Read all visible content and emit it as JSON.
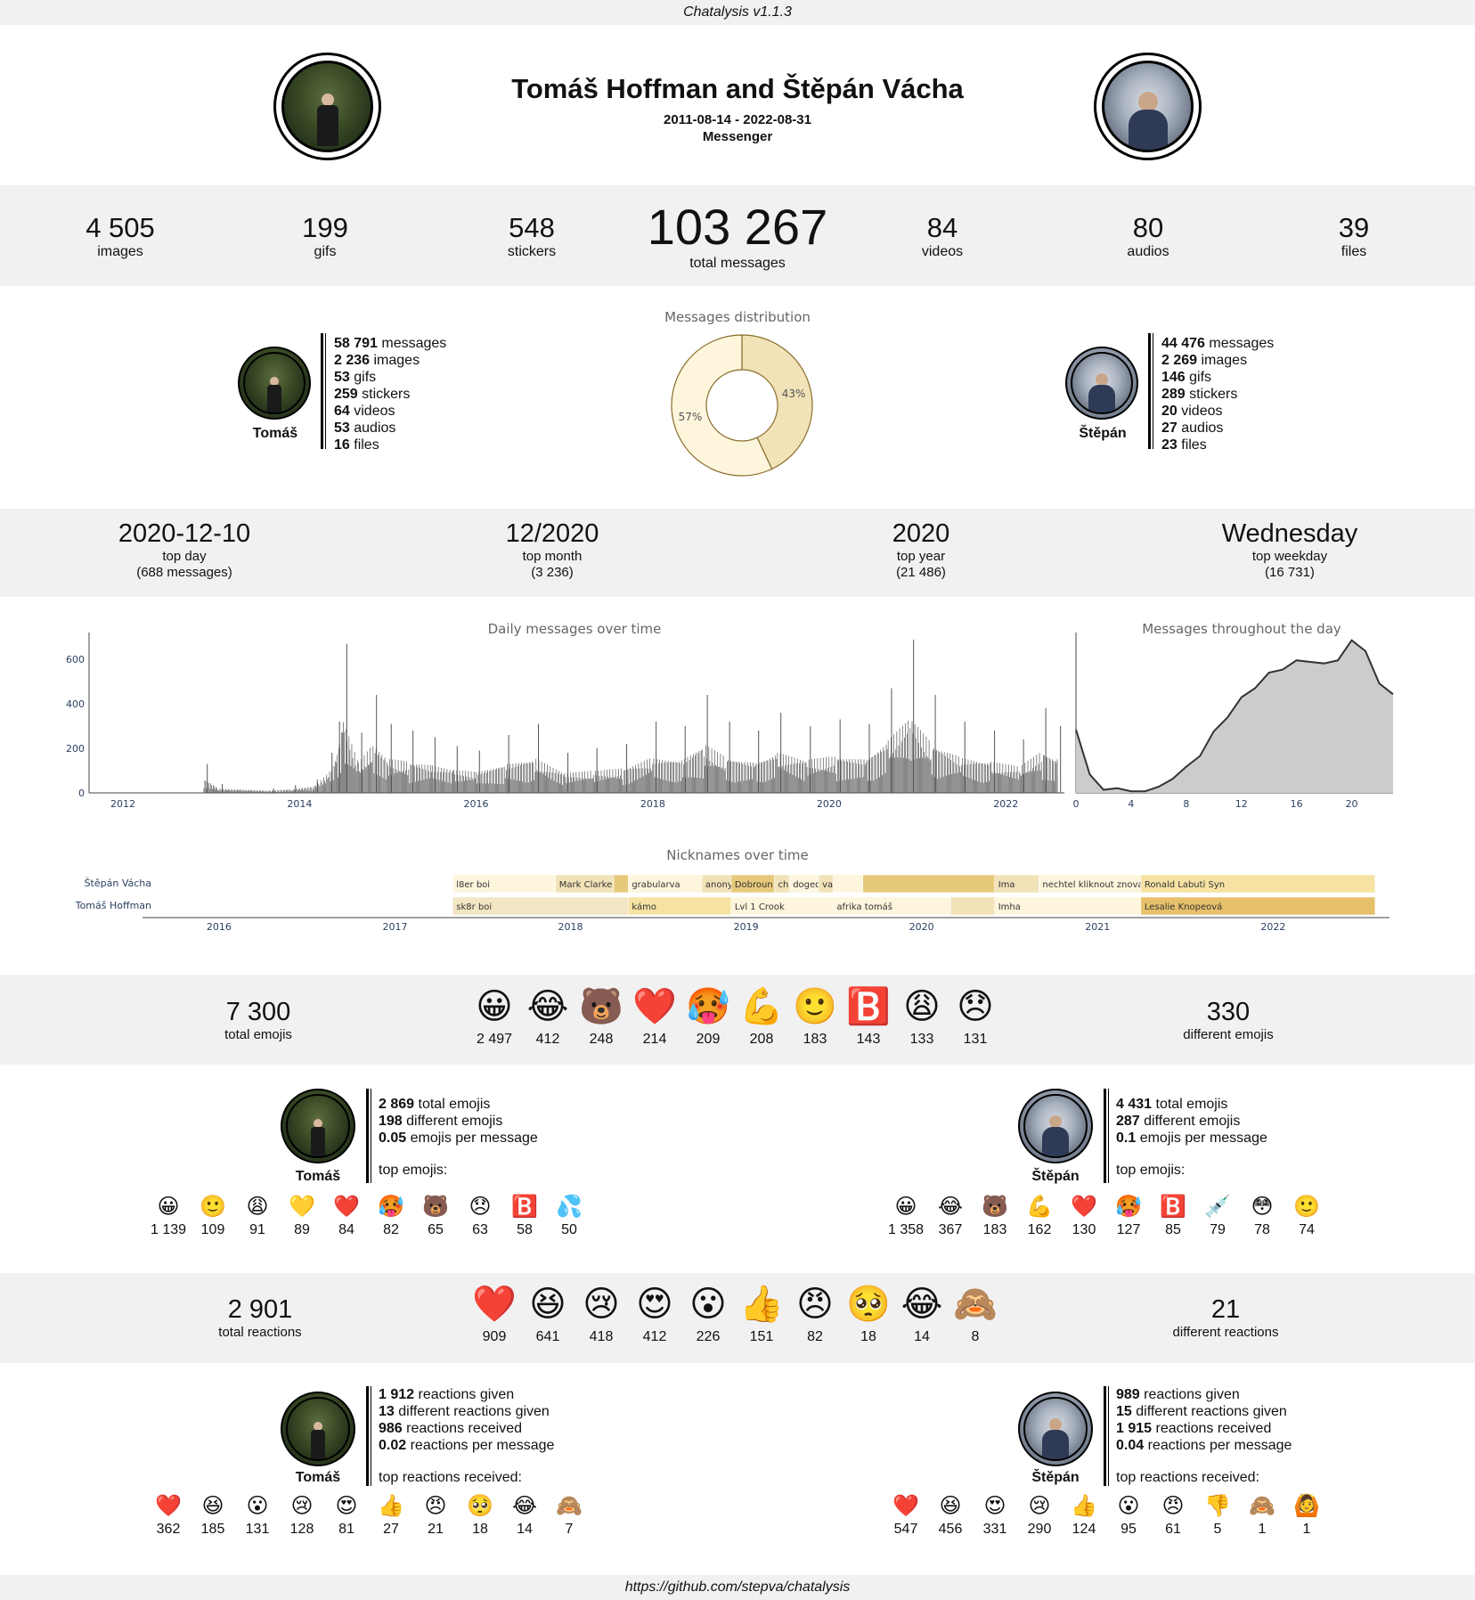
{
  "app": {
    "version_label": "Chatalysis v1.1.3",
    "footer_link": "https://github.com/stepva/chatalysis"
  },
  "header": {
    "title": "Tomáš Hoffman and Štěpán Vácha",
    "date_range": "2011-08-14 - 2022-08-31",
    "platform": "Messenger"
  },
  "stats": {
    "images": {
      "value": "4 505",
      "label": "images"
    },
    "gifs": {
      "value": "199",
      "label": "gifs"
    },
    "stickers": {
      "value": "548",
      "label": "stickers"
    },
    "total": {
      "value": "103 267",
      "label": "total messages"
    },
    "videos": {
      "value": "84",
      "label": "videos"
    },
    "audios": {
      "value": "80",
      "label": "audios"
    },
    "files": {
      "value": "39",
      "label": "files"
    }
  },
  "people": {
    "tomas": {
      "short_name": "Tomáš",
      "stats": [
        {
          "v": "58 791",
          "l": " messages"
        },
        {
          "v": "2 236",
          "l": " images"
        },
        {
          "v": "53",
          "l": " gifs"
        },
        {
          "v": "259",
          "l": " stickers"
        },
        {
          "v": "64",
          "l": " videos"
        },
        {
          "v": "53",
          "l": " audios"
        },
        {
          "v": "16",
          "l": " files"
        }
      ],
      "emoji_stats": [
        {
          "v": "2 869",
          "l": " total emojis"
        },
        {
          "v": "198",
          "l": " different emojis"
        },
        {
          "v": "0.05",
          "l": " emojis per message"
        }
      ],
      "top_emojis_label": "top emojis:",
      "top_emojis": [
        {
          "e": "😀",
          "c": "1 139"
        },
        {
          "e": "🙂",
          "c": "109"
        },
        {
          "e": "😩",
          "c": "91"
        },
        {
          "e": "💛",
          "c": "89"
        },
        {
          "e": "❤️",
          "c": "84"
        },
        {
          "e": "🥵",
          "c": "82"
        },
        {
          "e": "🐻",
          "c": "65"
        },
        {
          "e": "😞",
          "c": "63"
        },
        {
          "e": "🅱️",
          "c": "58"
        },
        {
          "e": "💦",
          "c": "50"
        }
      ],
      "reaction_stats": [
        {
          "v": "1 912",
          "l": " reactions given"
        },
        {
          "v": "13",
          "l": " different reactions given"
        },
        {
          "v": "986",
          "l": " reactions received"
        },
        {
          "v": "0.02",
          "l": " reactions per message"
        }
      ],
      "top_reactions_label": "top reactions received:",
      "top_reactions": [
        {
          "e": "❤️",
          "c": "362"
        },
        {
          "e": "😆",
          "c": "185"
        },
        {
          "e": "😮",
          "c": "131"
        },
        {
          "e": "😢",
          "c": "128"
        },
        {
          "e": "😍",
          "c": "81"
        },
        {
          "e": "👍",
          "c": "27"
        },
        {
          "e": "😠",
          "c": "21"
        },
        {
          "e": "🥺",
          "c": "18"
        },
        {
          "e": "😂",
          "c": "14"
        },
        {
          "e": "🙈",
          "c": "7"
        }
      ]
    },
    "stepan": {
      "short_name": "Štěpán",
      "stats": [
        {
          "v": "44 476",
          "l": " messages"
        },
        {
          "v": "2 269",
          "l": " images"
        },
        {
          "v": "146",
          "l": " gifs"
        },
        {
          "v": "289",
          "l": " stickers"
        },
        {
          "v": "20",
          "l": " videos"
        },
        {
          "v": "27",
          "l": " audios"
        },
        {
          "v": "23",
          "l": " files"
        }
      ],
      "emoji_stats": [
        {
          "v": "4 431",
          "l": " total emojis"
        },
        {
          "v": "287",
          "l": " different emojis"
        },
        {
          "v": "0.1",
          "l": " emojis per message"
        }
      ],
      "top_emojis_label": "top emojis:",
      "top_emojis": [
        {
          "e": "😀",
          "c": "1 358"
        },
        {
          "e": "😂",
          "c": "367"
        },
        {
          "e": "🐻",
          "c": "183"
        },
        {
          "e": "💪",
          "c": "162"
        },
        {
          "e": "❤️",
          "c": "130"
        },
        {
          "e": "🥵",
          "c": "127"
        },
        {
          "e": "🅱️",
          "c": "85"
        },
        {
          "e": "💉",
          "c": "79"
        },
        {
          "e": "😳",
          "c": "78"
        },
        {
          "e": "🙂",
          "c": "74"
        }
      ],
      "reaction_stats": [
        {
          "v": "989",
          "l": " reactions given"
        },
        {
          "v": "15",
          "l": " different reactions given"
        },
        {
          "v": "1 915",
          "l": " reactions received"
        },
        {
          "v": "0.04",
          "l": " reactions per message"
        }
      ],
      "top_reactions_label": "top reactions received:",
      "top_reactions": [
        {
          "e": "❤️",
          "c": "547"
        },
        {
          "e": "😆",
          "c": "456"
        },
        {
          "e": "😍",
          "c": "331"
        },
        {
          "e": "😢",
          "c": "290"
        },
        {
          "e": "👍",
          "c": "124"
        },
        {
          "e": "😮",
          "c": "95"
        },
        {
          "e": "😠",
          "c": "61"
        },
        {
          "e": "👎",
          "c": "5"
        },
        {
          "e": "🙈",
          "c": "1"
        },
        {
          "e": "🙆",
          "c": "1"
        }
      ]
    }
  },
  "tops": {
    "day": {
      "value": "2020-12-10",
      "label": "top day",
      "sub": "(688 messages)"
    },
    "month": {
      "value": "12/2020",
      "label": "top month",
      "sub": "(3 236)"
    },
    "year": {
      "value": "2020",
      "label": "top year",
      "sub": "(21 486)"
    },
    "weekday": {
      "value": "Wednesday",
      "label": "top weekday",
      "sub": "(16 731)"
    }
  },
  "emojis": {
    "total": {
      "value": "7 300",
      "label": "total emojis"
    },
    "different": {
      "value": "330",
      "label": "different emojis"
    },
    "top": [
      {
        "e": "😀",
        "c": "2 497"
      },
      {
        "e": "😂",
        "c": "412"
      },
      {
        "e": "🐻",
        "c": "248"
      },
      {
        "e": "❤️",
        "c": "214"
      },
      {
        "e": "🥵",
        "c": "209"
      },
      {
        "e": "💪",
        "c": "208"
      },
      {
        "e": "🙂",
        "c": "183"
      },
      {
        "e": "🅱️",
        "c": "143"
      },
      {
        "e": "😩",
        "c": "133"
      },
      {
        "e": "😞",
        "c": "131"
      }
    ]
  },
  "reactions": {
    "total": {
      "value": "2 901",
      "label": "total reactions"
    },
    "different": {
      "value": "21",
      "label": "different reactions"
    },
    "top": [
      {
        "e": "❤️",
        "c": "909"
      },
      {
        "e": "😆",
        "c": "641"
      },
      {
        "e": "😢",
        "c": "418"
      },
      {
        "e": "😍",
        "c": "412"
      },
      {
        "e": "😮",
        "c": "226"
      },
      {
        "e": "👍",
        "c": "151"
      },
      {
        "e": "😠",
        "c": "82"
      },
      {
        "e": "🥺",
        "c": "18"
      },
      {
        "e": "😂",
        "c": "14"
      },
      {
        "e": "🙈",
        "c": "8"
      }
    ]
  },
  "chart_data": [
    {
      "type": "pie",
      "title": "Messages distribution",
      "slices": [
        {
          "name": "Tomáš",
          "value": 57,
          "label": "57%",
          "color": "#fdf5dc"
        },
        {
          "name": "Štěpán",
          "value": 43,
          "label": "43%",
          "color": "#f1e2b8"
        }
      ]
    },
    {
      "type": "bar",
      "title": "Daily messages over time",
      "x_ticks": [
        "2012",
        "2014",
        "2016",
        "2018",
        "2020",
        "2022"
      ],
      "y_ticks": [
        "0",
        "200",
        "400",
        "600"
      ],
      "ylim": [
        0,
        720
      ],
      "xlim": [
        "2011-08-14",
        "2022-08-31"
      ],
      "color": "#555555",
      "monthly_peaks": [
        {
          "x": "2012-12",
          "y": 130
        },
        {
          "x": "2013-02",
          "y": 40
        },
        {
          "x": "2013-09",
          "y": 20
        },
        {
          "x": "2013-12",
          "y": 35
        },
        {
          "x": "2014-03",
          "y": 60
        },
        {
          "x": "2014-05",
          "y": 180
        },
        {
          "x": "2014-06",
          "y": 320
        },
        {
          "x": "2014-07",
          "y": 670
        },
        {
          "x": "2014-09",
          "y": 270
        },
        {
          "x": "2014-11",
          "y": 440
        },
        {
          "x": "2015-01",
          "y": 310
        },
        {
          "x": "2015-04",
          "y": 280
        },
        {
          "x": "2015-07",
          "y": 250
        },
        {
          "x": "2015-10",
          "y": 210
        },
        {
          "x": "2016-01",
          "y": 190
        },
        {
          "x": "2016-05",
          "y": 260
        },
        {
          "x": "2016-09",
          "y": 310
        },
        {
          "x": "2017-01",
          "y": 180
        },
        {
          "x": "2017-05",
          "y": 200
        },
        {
          "x": "2017-09",
          "y": 220
        },
        {
          "x": "2018-01",
          "y": 320
        },
        {
          "x": "2018-05",
          "y": 300
        },
        {
          "x": "2018-08",
          "y": 440
        },
        {
          "x": "2018-11",
          "y": 320
        },
        {
          "x": "2019-03",
          "y": 280
        },
        {
          "x": "2019-06",
          "y": 360
        },
        {
          "x": "2019-10",
          "y": 300
        },
        {
          "x": "2020-02",
          "y": 330
        },
        {
          "x": "2020-06",
          "y": 310
        },
        {
          "x": "2020-09",
          "y": 470
        },
        {
          "x": "2020-12",
          "y": 688
        },
        {
          "x": "2021-03",
          "y": 440
        },
        {
          "x": "2021-07",
          "y": 320
        },
        {
          "x": "2021-11",
          "y": 280
        },
        {
          "x": "2022-03",
          "y": 240
        },
        {
          "x": "2022-06",
          "y": 380
        },
        {
          "x": "2022-08",
          "y": 300
        }
      ]
    },
    {
      "type": "area",
      "title": "Messages throughout the day",
      "x_ticks": [
        "0",
        "4",
        "8",
        "12",
        "16",
        "20"
      ],
      "color": "#cccccc",
      "x": [
        0,
        1,
        2,
        3,
        4,
        5,
        6,
        7,
        8,
        9,
        10,
        11,
        12,
        13,
        14,
        15,
        16,
        17,
        18,
        19,
        20,
        21,
        22,
        23
      ],
      "y": [
        0.41,
        0.12,
        0.02,
        0.03,
        0.01,
        0.01,
        0.04,
        0.09,
        0.17,
        0.24,
        0.4,
        0.49,
        0.62,
        0.68,
        0.78,
        0.8,
        0.86,
        0.85,
        0.84,
        0.86,
        0.99,
        0.92,
        0.71,
        0.64
      ]
    },
    {
      "type": "timeline",
      "title": "Nicknames over time",
      "x_ticks": [
        "2016",
        "2017",
        "2018",
        "2019",
        "2020",
        "2021",
        "2022"
      ],
      "rows": [
        {
          "name": "Štěpán Vácha",
          "segments": [
            {
              "label": "l8er boi",
              "from": "2017-05",
              "to": "2017-12",
              "color": "#fdf5dc"
            },
            {
              "label": "Mark Clarke",
              "from": "2017-12",
              "to": "2018-04",
              "color": "#f1e2b8"
            },
            {
              "label": "",
              "from": "2018-04",
              "to": "2018-05",
              "color": "#e6c97b"
            },
            {
              "label": "grabularva",
              "from": "2018-05",
              "to": "2018-10",
              "color": "#fdf5dc"
            },
            {
              "label": "anonymní",
              "from": "2018-10",
              "to": "2018-12",
              "color": "#f1e2b8"
            },
            {
              "label": "Dobroun",
              "from": "2018-12",
              "to": "2019-03",
              "color": "#e6c97b"
            },
            {
              "label": "chull",
              "from": "2019-03",
              "to": "2019-04",
              "color": "#f1e2b8"
            },
            {
              "label": "dogedos",
              "from": "2019-04",
              "to": "2019-06",
              "color": "#fdf5dc"
            },
            {
              "label": "vagob",
              "from": "2019-06",
              "to": "2019-07",
              "color": "#f1e2b8"
            },
            {
              "label": "",
              "from": "2019-07",
              "to": "2019-09",
              "color": "#fdf5dc"
            },
            {
              "label": "",
              "from": "2019-09",
              "to": "2020-06",
              "color": "#e6c97b"
            },
            {
              "label": "Ima",
              "from": "2020-06",
              "to": "2020-09",
              "color": "#f1e2b8"
            },
            {
              "label": "nechtel kliknout znova",
              "from": "2020-09",
              "to": "2021-04",
              "color": "#fdf5dc"
            },
            {
              "label": "Ronald Labuti Syn",
              "from": "2021-04",
              "to": "2022-08",
              "color": "#f6e3a3"
            }
          ]
        },
        {
          "name": "Tomáš Hoffman",
          "segments": [
            {
              "label": "sk8r boi",
              "from": "2017-05",
              "to": "2018-05",
              "color": "#f3e6c4"
            },
            {
              "label": "kámo",
              "from": "2018-05",
              "to": "2018-12",
              "color": "#f6e3a3"
            },
            {
              "label": "Lvl 1 Crook",
              "from": "2018-12",
              "to": "2019-07",
              "color": "#fdf5dc"
            },
            {
              "label": "afrika tomáš",
              "from": "2019-07",
              "to": "2020-03",
              "color": "#fdf5dc"
            },
            {
              "label": "",
              "from": "2020-03",
              "to": "2020-06",
              "color": "#f1e2b8"
            },
            {
              "label": "Imha",
              "from": "2020-06",
              "to": "2021-04",
              "color": "#fdf5dc"
            },
            {
              "label": "Lesalie Knopeová",
              "from": "2021-04",
              "to": "2022-08",
              "color": "#e6c06a"
            }
          ]
        }
      ]
    }
  ]
}
